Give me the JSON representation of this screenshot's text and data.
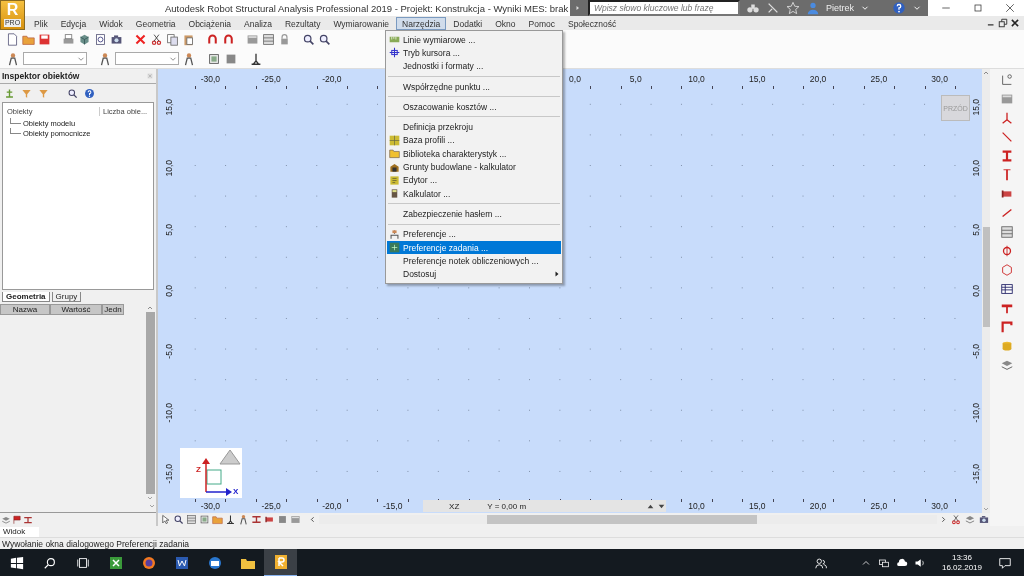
{
  "window": {
    "title": "Autodesk Robot Structural Analysis Professional 2019 - Projekt: Konstrukcja - Wyniki MES: brak",
    "logo": {
      "letter": "R",
      "edition": "PRO"
    },
    "search": {
      "placeholder": "Wpisz słowo kluczowe lub frazę"
    },
    "user": "Pietrek"
  },
  "menu_bar": [
    {
      "label": "Plik",
      "selected": false
    },
    {
      "label": "Edycja",
      "selected": false
    },
    {
      "label": "Widok",
      "selected": false
    },
    {
      "label": "Geometria",
      "selected": false
    },
    {
      "label": "Obciążenia",
      "selected": false
    },
    {
      "label": "Analiza",
      "selected": false
    },
    {
      "label": "Rezultaty",
      "selected": false
    },
    {
      "label": "Wymiarowanie",
      "selected": false
    },
    {
      "label": "Narzędzia",
      "selected": true
    },
    {
      "label": "Dodatki",
      "selected": false
    },
    {
      "label": "Okno",
      "selected": false
    },
    {
      "label": "Pomoc",
      "selected": false
    },
    {
      "label": "Społeczność",
      "selected": false
    }
  ],
  "open_menu": {
    "items": [
      {
        "kind": "item",
        "label": "Linie wymiarowe ...",
        "selected": false,
        "submenu": false
      },
      {
        "kind": "item",
        "label": "Tryb kursora ...",
        "selected": false,
        "submenu": false
      },
      {
        "kind": "item",
        "label": "Jednostki i formaty ...",
        "selected": false,
        "submenu": false
      },
      {
        "kind": "separator"
      },
      {
        "kind": "item",
        "label": "Współrzędne punktu ...",
        "selected": false,
        "submenu": false
      },
      {
        "kind": "separator"
      },
      {
        "kind": "item",
        "label": "Oszacowanie kosztów ...",
        "selected": false,
        "submenu": false
      },
      {
        "kind": "separator"
      },
      {
        "kind": "item",
        "label": "Definicja przekroju",
        "selected": false,
        "submenu": false
      },
      {
        "kind": "item",
        "label": "Baza profili ...",
        "selected": false,
        "submenu": false
      },
      {
        "kind": "item",
        "label": "Biblioteka charakterystyk ...",
        "selected": false,
        "submenu": false
      },
      {
        "kind": "item",
        "label": "Grunty budowlane - kalkulator",
        "selected": false,
        "submenu": false
      },
      {
        "kind": "item",
        "label": "Edytor ...",
        "selected": false,
        "submenu": false
      },
      {
        "kind": "item",
        "label": "Kalkulator ...",
        "selected": false,
        "submenu": false
      },
      {
        "kind": "separator"
      },
      {
        "kind": "item",
        "label": "Zabezpieczenie hasłem ...",
        "selected": false,
        "submenu": false
      },
      {
        "kind": "separator"
      },
      {
        "kind": "item",
        "label": "Preferencje ...",
        "selected": false,
        "submenu": false
      },
      {
        "kind": "item",
        "label": "Preferencje zadania ...",
        "selected": true,
        "submenu": false
      },
      {
        "kind": "item",
        "label": "Preferencje notek obliczeniowych ...",
        "selected": false,
        "submenu": false
      },
      {
        "kind": "item",
        "label": "Dostosuj",
        "selected": false,
        "submenu": true
      }
    ]
  },
  "object_inspector": {
    "title": "Inspektor obiektów",
    "columns": [
      "Obiekty",
      "Liczba obie..."
    ],
    "tree": [
      {
        "label": "Obiekty modelu"
      },
      {
        "label": "Obiekty pomocnicze"
      }
    ],
    "tabs": [
      {
        "label": "Geometria",
        "selected": true
      },
      {
        "label": "Grupy",
        "selected": false
      }
    ],
    "property_columns": [
      "Nazwa",
      "Wartość",
      "Jedn"
    ]
  },
  "view": {
    "top_ruler": [
      "-30,0",
      "-25,0",
      "-20,0",
      "0,0",
      "5,0",
      "10,0",
      "15,0",
      "20,0",
      "25,0",
      "30,0"
    ],
    "left_ruler": [
      "15,0",
      "10,0",
      "5,0",
      "0,0",
      "-5,0",
      "-10,0",
      "-15,0"
    ],
    "right_ruler": [
      "15,0",
      "10,0",
      "5,0",
      "0,0",
      "-5,0",
      "-10,0",
      "-15,0"
    ],
    "bottom_ruler": [
      "-30,0",
      "-25,0",
      "-20,0",
      "-15,0",
      "10,0",
      "15,0",
      "20,0",
      "25,0",
      "30,0"
    ],
    "view_button": "PRZÓD",
    "plane": "XZ",
    "plane_offset": "Y = 0,00 m",
    "axis_labels": [
      "Z",
      "X"
    ]
  },
  "status_bar": {
    "tab": "Widok",
    "message": "Wywołanie okna dialogowego Preferencji zadania"
  },
  "taskbar": {
    "apps": [
      {
        "selected": false
      },
      {
        "selected": false
      },
      {
        "selected": false
      },
      {
        "selected": false
      },
      {
        "selected": false
      },
      {
        "selected": true
      }
    ],
    "time": "13:36",
    "date": "16.02.2019"
  }
}
